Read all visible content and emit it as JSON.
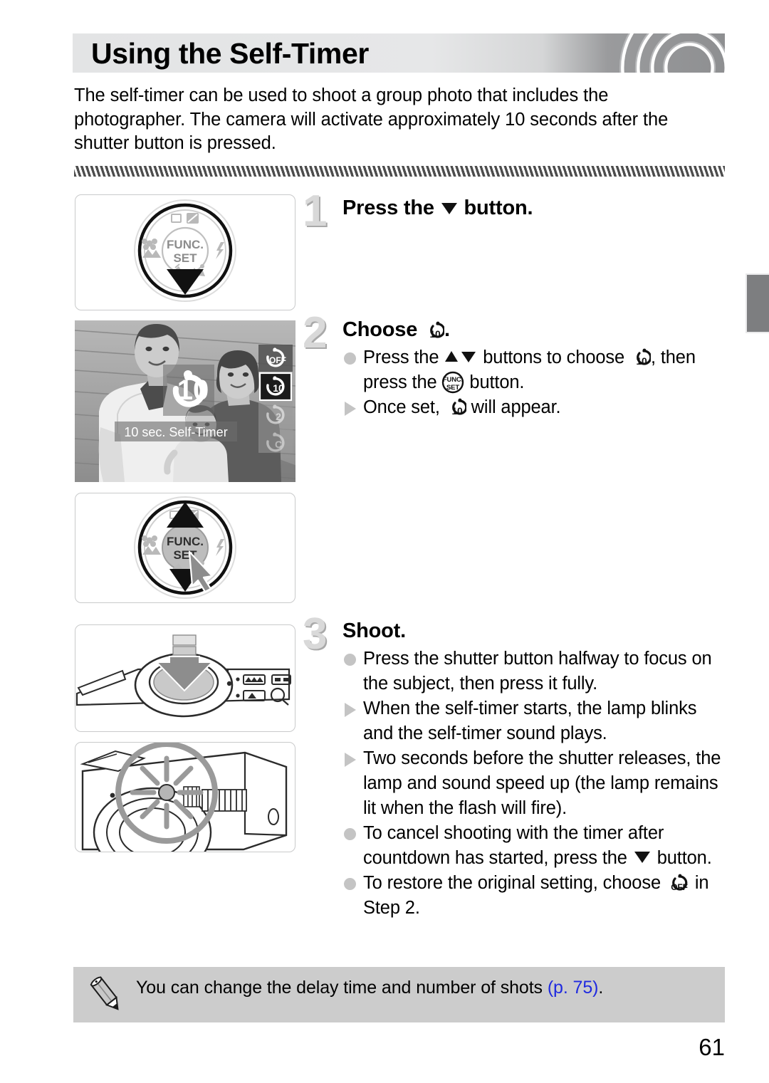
{
  "page": {
    "title": "Using the Self-Timer",
    "number": "61",
    "intro": "The self-timer can be used to shoot a group photo that includes the photographer. The camera will activate approximately 10 seconds after the shutter button is pressed."
  },
  "steps": [
    {
      "number": "1",
      "heading_before": "Press the",
      "heading_icon": "down-button-icon",
      "heading_after": "button.",
      "bullets": []
    },
    {
      "number": "2",
      "heading_before": "Choose",
      "heading_icon": "self-timer-10sec-icon",
      "heading_after": ".",
      "bullets": [
        {
          "marker": "dot",
          "parts": [
            "Press the ",
            "up-down-buttons-icon",
            " buttons to choose ",
            "self-timer-10sec-icon",
            ", then press the ",
            "func-set-icon",
            " button."
          ]
        },
        {
          "marker": "triangle",
          "parts": [
            "Once set, ",
            "self-timer-10sec-icon",
            " will appear."
          ]
        }
      ]
    },
    {
      "number": "3",
      "heading_before": "Shoot.",
      "heading_icon": "",
      "heading_after": "",
      "bullets": [
        {
          "marker": "dot",
          "parts": [
            "Press the shutter button halfway to focus on the subject, then press it fully."
          ]
        },
        {
          "marker": "triangle",
          "parts": [
            "When the self-timer starts, the lamp blinks and the self-timer sound plays."
          ]
        },
        {
          "marker": "triangle",
          "parts": [
            "Two seconds before the shutter releases, the lamp and sound speed up (the lamp remains lit when the flash will fire)."
          ]
        },
        {
          "marker": "dot",
          "parts": [
            "To cancel shooting with the timer after countdown has started, press the ",
            "down-button-icon",
            " button."
          ]
        },
        {
          "marker": "dot",
          "parts": [
            "To restore the original setting, choose ",
            "self-timer-off-icon",
            " in Step 2."
          ]
        }
      ]
    }
  ],
  "step_text": {
    "s1_head_before": "Press the",
    "s1_head_after": "button.",
    "s2_head_before": "Choose",
    "s2_head_after": ".",
    "s2_b1_p1": "Press the",
    "s2_b1_p2": "buttons to choose",
    "s2_b1_p3": ", then press the",
    "s2_b1_p4": "button.",
    "s2_b2_p1": "Once set,",
    "s2_b2_p2": "will appear.",
    "s3_head": "Shoot.",
    "s3_b1": "Press the shutter button halfway to focus on the subject, then press it fully.",
    "s3_b2": "When the self-timer starts, the lamp blinks and the self-timer sound plays.",
    "s3_b3": "Two seconds before the shutter releases, the lamp and sound speed up (the lamp remains lit when the flash will fire).",
    "s3_b4_p1": "To cancel shooting with the timer after countdown has started, press the",
    "s3_b4_p2": "button.",
    "s3_b5_p1": "To restore the original setting, choose",
    "s3_b5_p2": "in Step 2."
  },
  "note": {
    "icon": "pencil-icon",
    "text_before": "You can change the delay time and number of shots",
    "page_ref": "(p. 75)",
    "text_after": "."
  },
  "figures": {
    "dial_step1": {
      "name": "control-dial-down-press",
      "center_label_line1": "FUNC.",
      "center_label_line2": "SET"
    },
    "camera_screen": {
      "name": "self-timer-menu-screen",
      "status_label": "10 sec. Self-Timer",
      "overlay_value": "10",
      "menu_options": [
        {
          "label": "OFF",
          "selected": false
        },
        {
          "label": "10",
          "selected": true
        },
        {
          "label": "2",
          "selected": false
        },
        {
          "label": "C",
          "selected": false
        }
      ]
    },
    "dial_step2": {
      "name": "control-dial-func-set-press",
      "center_label_line1": "FUNC.",
      "center_label_line2": "SET"
    },
    "shutter": {
      "name": "shutter-button-press"
    },
    "lamp": {
      "name": "camera-front-lamp"
    }
  },
  "colors": {
    "header_light": "#e6e7e8",
    "header_dark": "#8e8f91",
    "step_number": "#d9d9d9",
    "bullet_gray": "#c4c4c4",
    "note_bg": "#cccccc",
    "page_ref_blue": "#1f2ae0",
    "edge_tab": "#7d7e80"
  }
}
